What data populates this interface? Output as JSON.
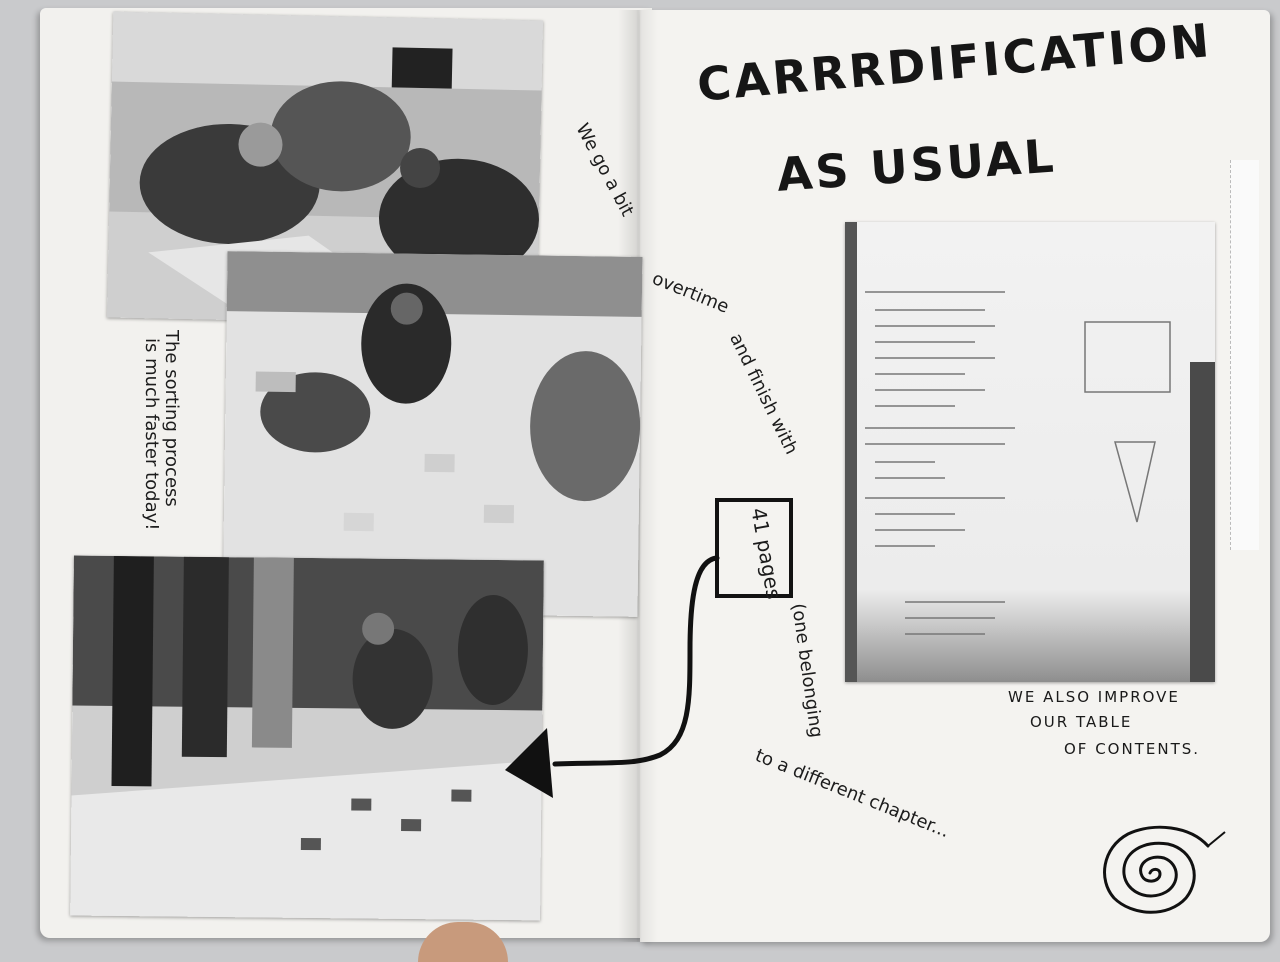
{
  "title": {
    "line1": "CARRRDIFICATION",
    "line2": "AS USUAL"
  },
  "notes": {
    "left_margin": {
      "line1": "The sorting process",
      "line2": "is much faster today!"
    },
    "curve": {
      "part1": "We go a bit",
      "part2": "overtime",
      "part3": "and finish with",
      "boxed": "41 pages",
      "part4": "(one belonging",
      "part5": "to a different chapter..."
    },
    "bottom_right": {
      "line1": "WE ALSO IMPROVE",
      "line2": "OUR TABLE",
      "line3": "OF CONTENTS."
    }
  },
  "colors": {
    "ink": "#1a1a1a",
    "paper": "#f2f1ee",
    "background": "#c9cacc"
  },
  "icons": [
    "spiral-doodle-icon",
    "arrow-head-icon"
  ]
}
